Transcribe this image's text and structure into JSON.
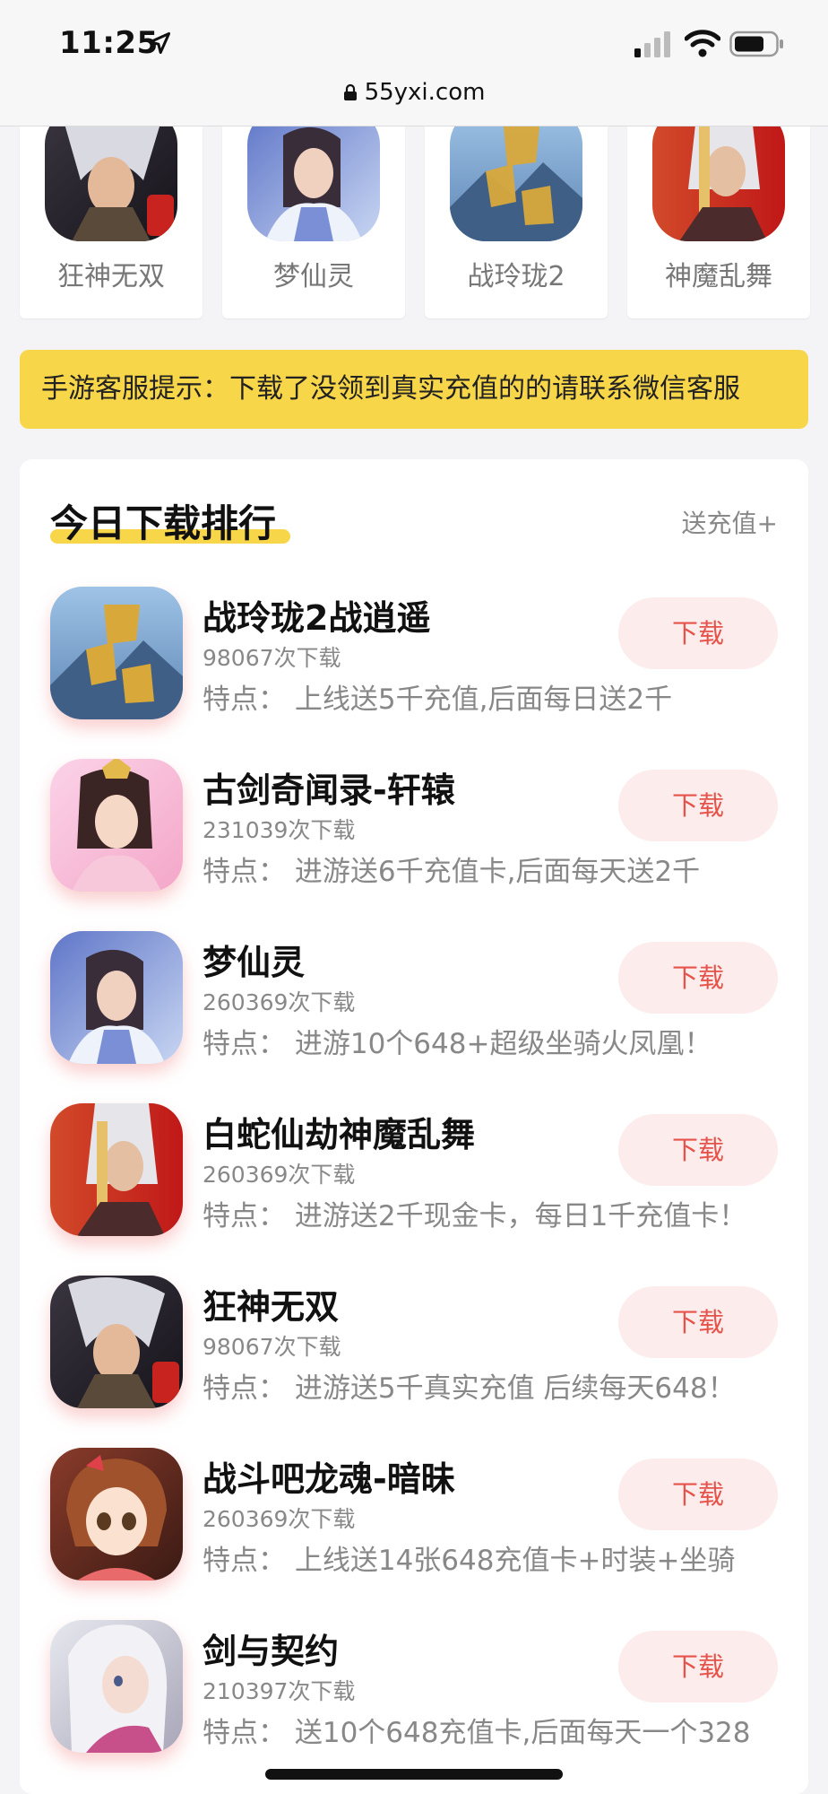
{
  "status": {
    "time": "11:25"
  },
  "browser": {
    "url": "55yxi.com"
  },
  "top_games": [
    {
      "name": "狂神无双",
      "icon": "game-icon-kuangshen"
    },
    {
      "name": "梦仙灵",
      "icon": "game-icon-mengxianling"
    },
    {
      "name": "战玲珑2",
      "icon": "game-icon-zhanlinglong"
    },
    {
      "name": "神魔乱舞",
      "icon": "game-icon-shenmo"
    }
  ],
  "notice": {
    "text": "手游客服提示：下载了没领到真实充值的的请联系微信客服"
  },
  "ranking": {
    "title": "今日下载排行",
    "more": "送充值+",
    "items": [
      {
        "title": "战玲珑2战逍遥",
        "count": "98067次下载",
        "feature": "特点：  上线送5千充值,后面每日送2千",
        "button": "下载"
      },
      {
        "title": "古剑奇闻录-轩辕",
        "count": "231039次下载",
        "feature": "特点：  进游送6千充值卡,后面每天送2千",
        "button": "下载"
      },
      {
        "title": "梦仙灵",
        "count": "260369次下载",
        "feature": "特点：  进游10个648+超级坐骑火凤凰！",
        "button": "下载"
      },
      {
        "title": "白蛇仙劫神魔乱舞",
        "count": "260369次下载",
        "feature": "特点：  进游送2千现金卡，每日1千充值卡！",
        "button": "下载"
      },
      {
        "title": "狂神无双",
        "count": "98067次下载",
        "feature": "特点：  进游送5千真实充值 后续每天648！",
        "button": "下载"
      },
      {
        "title": "战斗吧龙魂-暗昧",
        "count": "260369次下载",
        "feature": "特点：  上线送14张648充值卡+时装+坐骑",
        "button": "下载"
      },
      {
        "title": "剑与契约",
        "count": "210397次下载",
        "feature": "特点：  送10个648充值卡,后面每天一个328",
        "button": "下载"
      }
    ]
  },
  "colors": {
    "accent_yellow": "#f8d64a",
    "download_text": "#e5534b",
    "download_bg": "#fcecec"
  }
}
